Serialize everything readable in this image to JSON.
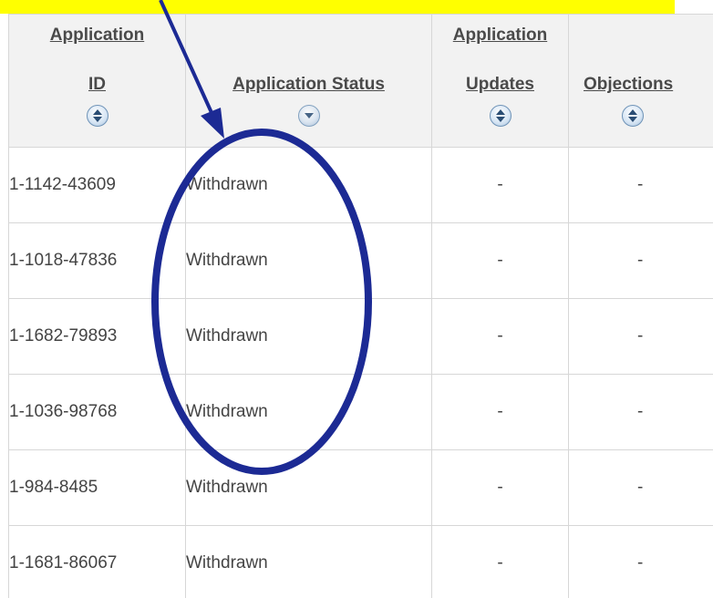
{
  "table": {
    "headers": [
      {
        "lines": [
          "Application",
          "ID"
        ]
      },
      {
        "lines": [
          "",
          "Application Status"
        ]
      },
      {
        "lines": [
          "Application",
          "Updates"
        ]
      },
      {
        "lines": [
          "",
          "Objections"
        ]
      }
    ],
    "rows": [
      {
        "id": "1-1142-43609",
        "status": "Withdrawn",
        "updates": "-",
        "objections": "-"
      },
      {
        "id": "1-1018-47836",
        "status": "Withdrawn",
        "updates": "-",
        "objections": "-"
      },
      {
        "id": "1-1682-79893",
        "status": "Withdrawn",
        "updates": "-",
        "objections": "-"
      },
      {
        "id": "1-1036-98768",
        "status": "Withdrawn",
        "updates": "-",
        "objections": "-"
      },
      {
        "id": "1-984-8485",
        "status": "Withdrawn",
        "updates": "-",
        "objections": "-"
      },
      {
        "id": "1-1681-86067",
        "status": "Withdrawn",
        "updates": "-",
        "objections": "-"
      }
    ]
  },
  "annotation": {
    "banner_color": "#ffff00",
    "arrow_color": "#1c2a94",
    "ellipse_color": "#1c2a94"
  },
  "icons": {
    "sort": "sort-updown-icon"
  }
}
